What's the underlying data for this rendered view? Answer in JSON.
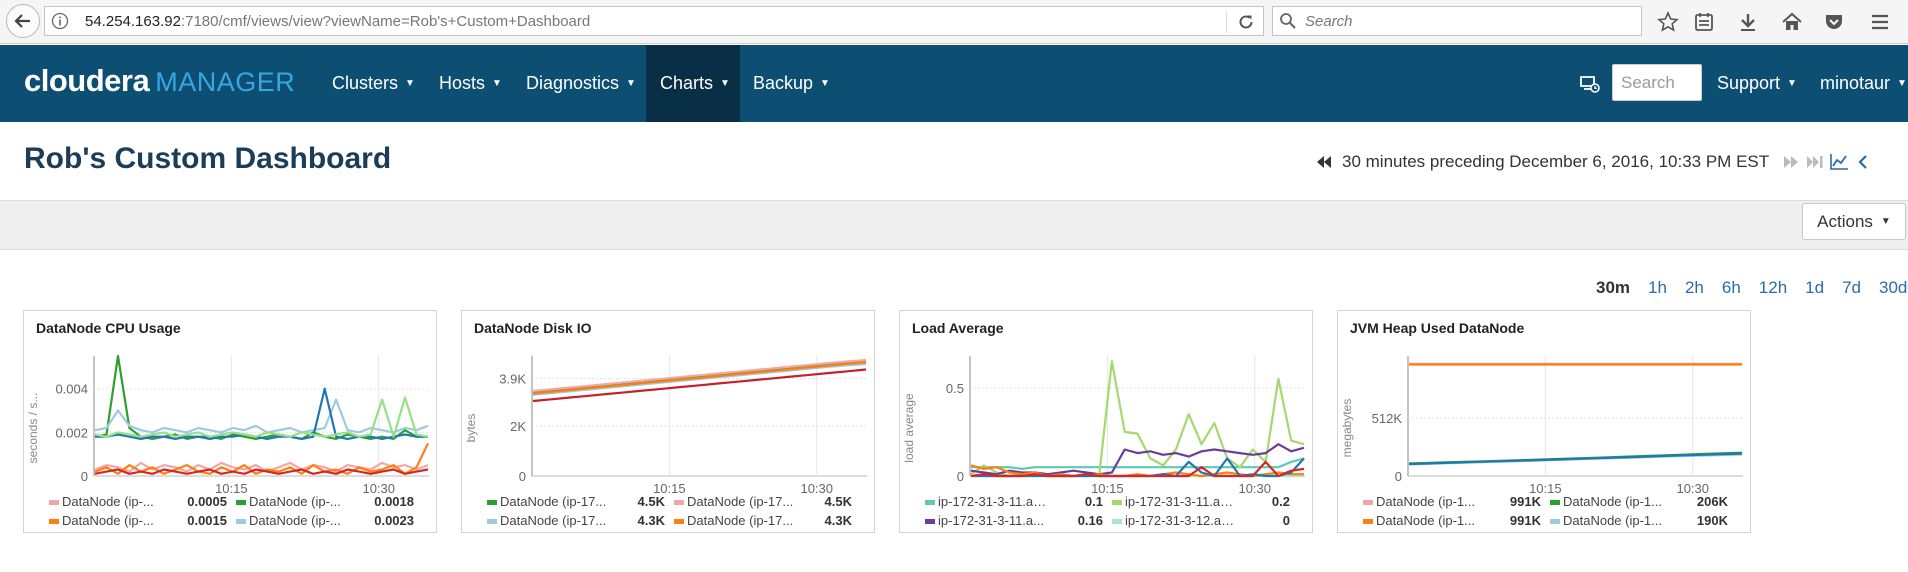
{
  "browser": {
    "url_host": "54.254.163.92",
    "url_rest": ":7180/cmf/views/view?viewName=Rob's+Custom+Dashboard",
    "search_placeholder": "Search"
  },
  "nav": {
    "logo_main": "cloudera",
    "logo_sub": "MANAGER",
    "items": [
      {
        "label": "Clusters"
      },
      {
        "label": "Hosts"
      },
      {
        "label": "Diagnostics"
      },
      {
        "label": "Charts"
      },
      {
        "label": "Backup"
      }
    ],
    "search_placeholder": "Search",
    "support": "Support",
    "user": "minotaur"
  },
  "page": {
    "title": "Rob's Custom Dashboard",
    "time_range_text": "30 minutes preceding December 6, 2016, 10:33 PM EST",
    "actions_label": "Actions",
    "ranges": [
      "30m",
      "1h",
      "2h",
      "6h",
      "12h",
      "1d",
      "7d",
      "30d"
    ],
    "active_range": "30m"
  },
  "chart_data": [
    {
      "type": "line",
      "title": "DataNode CPU Usage",
      "ylabel": "seconds / s...",
      "x_ticks": [
        "10:15",
        "10:30"
      ],
      "y_ticks": [
        "0.004",
        "0.002",
        "0"
      ],
      "ylim": [
        0,
        0.0055
      ],
      "series": [
        {
          "name": "DataNode (ip-...",
          "value_label": "0.0005",
          "color": "#f4a5a5",
          "values": [
            0.0003,
            0.0005,
            0.0004,
            0.0002,
            0.0006,
            0.0003,
            0.0005,
            0.0004,
            0.0002,
            0.0005,
            0.0003,
            0.0006,
            0.0004,
            0.0003,
            0.0005,
            0.0002,
            0.0004,
            0.0006,
            0.0003,
            0.0005,
            0.0004,
            0.0002,
            0.0005,
            0.0004,
            0.0003,
            0.0006,
            0.0004,
            0.0005,
            0.0003,
            0.0005
          ]
        },
        {
          "name": "DataNode (ip-...",
          "value_label": "0.0018",
          "color": "#2ca02c",
          "values": [
            0.0018,
            0.0019,
            0.0055,
            0.0022,
            0.0018,
            0.0017,
            0.0018,
            0.0019,
            0.0017,
            0.0018,
            0.0018,
            0.0017,
            0.0019,
            0.0018,
            0.0017,
            0.0018,
            0.0019,
            0.0018,
            0.0017,
            0.002,
            0.0018,
            0.0017,
            0.0019,
            0.0018,
            0.0017,
            0.0018,
            0.0017,
            0.0021,
            0.0018,
            0.0018
          ]
        },
        {
          "name": "DataNode (ip-...",
          "value_label": "0.0015",
          "color": "#ff7f0e",
          "values": [
            0.0002,
            0.0004,
            0.0001,
            0.0005,
            0.0002,
            0.0004,
            0.0001,
            0.0003,
            0.0005,
            0.0002,
            0.0001,
            0.0004,
            0.0002,
            0.0005,
            0.0001,
            0.0003,
            0.0002,
            0.0004,
            0.0001,
            0.0005,
            0.0002,
            0.0003,
            0.0001,
            0.0004,
            0.0002,
            0.0003,
            0.0005,
            0.0001,
            0.0004,
            0.0015
          ]
        },
        {
          "name": "DataNode (ip-...",
          "value_label": "0.0023",
          "color": "#9ecae1",
          "values": [
            0.0021,
            0.0022,
            0.003,
            0.0023,
            0.0021,
            0.002,
            0.0022,
            0.0021,
            0.002,
            0.0022,
            0.0021,
            0.002,
            0.0022,
            0.0021,
            0.0023,
            0.002,
            0.0021,
            0.0022,
            0.002,
            0.0021,
            0.0022,
            0.0035,
            0.0021,
            0.002,
            0.0022,
            0.0021,
            0.002,
            0.0022,
            0.0021,
            0.0023
          ]
        },
        {
          "name": "",
          "value_label": "",
          "color": "#1f77b4",
          "values": [
            0.0018,
            0.0018,
            0.0019,
            0.0018,
            0.0017,
            0.0018,
            0.0018,
            0.0017,
            0.0018,
            0.0018,
            0.0017,
            0.0018,
            0.0018,
            0.0019,
            0.0018,
            0.0017,
            0.0018,
            0.0018,
            0.0017,
            0.0018,
            0.004,
            0.0018,
            0.0017,
            0.0018,
            0.0018,
            0.0017,
            0.0018,
            0.0019,
            0.0018,
            0.0018
          ]
        },
        {
          "name": "",
          "value_label": "",
          "color": "#98df8a",
          "values": [
            0.0019,
            0.0018,
            0.002,
            0.0019,
            0.0018,
            0.0019,
            0.002,
            0.0018,
            0.0019,
            0.002,
            0.0018,
            0.0019,
            0.002,
            0.0019,
            0.0018,
            0.002,
            0.0019,
            0.0018,
            0.002,
            0.0019,
            0.0018,
            0.0019,
            0.002,
            0.0018,
            0.0019,
            0.0035,
            0.0018,
            0.0036,
            0.0019,
            0.0018
          ]
        },
        {
          "name": "",
          "value_label": "",
          "color": "#d62728",
          "values": [
            0.0001,
            0.0002,
            0.0003,
            0.0001,
            0.0002,
            0.0001,
            0.0003,
            0.0002,
            0.0001,
            0.0002,
            0.0003,
            0.0001,
            0.0002,
            0.0001,
            0.0003,
            0.0002,
            0.0001,
            0.0002,
            0.0003,
            0.0001,
            0.0002,
            0.0001,
            0.0003,
            0.0002,
            0.0001,
            0.0002,
            0.0003,
            0.0001,
            0.0002,
            0.0003
          ]
        }
      ]
    },
    {
      "type": "line",
      "title": "DataNode Disk IO",
      "ylabel": "bytes",
      "x_ticks": [
        "10:15",
        "10:30"
      ],
      "y_ticks": [
        "3.9K",
        "2K",
        "0"
      ],
      "ylim": [
        0,
        4800
      ],
      "series": [
        {
          "name": "DataNode (ip-17...",
          "value_label": "4.5K",
          "color": "#2ca02c",
          "values": [
            3350,
            3420,
            3490,
            3560,
            3630,
            3700,
            3770,
            3840,
            3910,
            3980,
            4050,
            4120,
            4190,
            4260,
            4330,
            4400,
            4470,
            4540,
            4600
          ]
        },
        {
          "name": "DataNode (ip-17...",
          "value_label": "4.5K",
          "color": "#f4a5a5",
          "values": [
            3400,
            3470,
            3540,
            3610,
            3680,
            3750,
            3820,
            3890,
            3960,
            4030,
            4100,
            4170,
            4240,
            4310,
            4380,
            4450,
            4520,
            4580,
            4640
          ]
        },
        {
          "name": "DataNode (ip-17...",
          "value_label": "4.3K",
          "color": "#9ecae1",
          "values": [
            3250,
            3320,
            3390,
            3460,
            3530,
            3600,
            3670,
            3740,
            3810,
            3880,
            3950,
            4020,
            4090,
            4160,
            4230,
            4300,
            4370,
            4430,
            4480
          ]
        },
        {
          "name": "DataNode (ip-17...",
          "value_label": "4.3K",
          "color": "#ff7f0e",
          "values": [
            3300,
            3370,
            3440,
            3510,
            3580,
            3650,
            3720,
            3790,
            3860,
            3930,
            4000,
            4070,
            4140,
            4210,
            4280,
            4350,
            4420,
            4490,
            4550
          ]
        },
        {
          "name": "",
          "value_label": "",
          "color": "#c7202d",
          "values": [
            3000,
            3070,
            3140,
            3210,
            3280,
            3350,
            3420,
            3490,
            3560,
            3630,
            3700,
            3770,
            3840,
            3910,
            3980,
            4050,
            4120,
            4190,
            4260
          ]
        }
      ]
    },
    {
      "type": "line",
      "title": "Load Average",
      "ylabel": "load average",
      "x_ticks": [
        "10:15",
        "10:30"
      ],
      "y_ticks": [
        "0.5",
        "0"
      ],
      "ylim": [
        0,
        0.68
      ],
      "series": [
        {
          "name": "ip-172-31-3-11.ap...",
          "value_label": "0.1",
          "color": "#5fc9b6",
          "values": [
            0.05,
            0.05,
            0.05,
            0.05,
            0.04,
            0.05,
            0.05,
            0.05,
            0.05,
            0.05,
            0.05,
            0.05,
            0.05,
            0.05,
            0.05,
            0.05,
            0.05,
            0.05,
            0.05,
            0.05,
            0.05,
            0.05,
            0.05,
            0.05,
            0.05,
            0.08,
            0.1
          ]
        },
        {
          "name": "ip-172-31-3-11.ap...",
          "value_label": "0.2",
          "color": "#a5d86e",
          "values": [
            0.01,
            0.06,
            0.02,
            0.0,
            0.01,
            0.02,
            0.0,
            0.01,
            0.0,
            0.01,
            0.0,
            0.65,
            0.25,
            0.24,
            0.1,
            0.06,
            0.15,
            0.35,
            0.18,
            0.3,
            0.1,
            0.05,
            0.15,
            0.08,
            0.55,
            0.2,
            0.18
          ]
        },
        {
          "name": "ip-172-31-3-11.a...",
          "value_label": "0.16",
          "color": "#6a3d9a",
          "values": [
            0.03,
            0.02,
            0.01,
            0.03,
            0.02,
            0.02,
            0.01,
            0.02,
            0.03,
            0.02,
            0.01,
            0.02,
            0.15,
            0.13,
            0.14,
            0.12,
            0.13,
            0.11,
            0.14,
            0.15,
            0.14,
            0.13,
            0.12,
            0.13,
            0.18,
            0.14,
            0.16
          ]
        },
        {
          "name": "ip-172-31-3-12.ap-s...",
          "value_label": "0",
          "color": "#a8e6c8",
          "values": [
            0.0,
            0.0,
            0.0,
            0.0,
            0.0,
            0.0,
            0.0,
            0.0,
            0.0,
            0.0,
            0.0,
            0.0,
            0.0,
            0.0,
            0.0,
            0.0,
            0.0,
            0.0,
            0.0,
            0.0,
            0.0,
            0.0,
            0.0,
            0.0,
            0.0,
            0.0,
            0.0
          ]
        },
        {
          "name": "",
          "value_label": "",
          "color": "#ff7f0e",
          "values": [
            0.06,
            0.04,
            0.05,
            0.02,
            0.01,
            0.02,
            0.0,
            0.01,
            0.0,
            0.0,
            0.01,
            0.0,
            0.0,
            0.01,
            0.0,
            0.01,
            0.02,
            0.01,
            0.0,
            0.01,
            0.02,
            0.01,
            0.0,
            0.01,
            0.02,
            0.01,
            0.01
          ]
        },
        {
          "name": "",
          "value_label": "",
          "color": "#1f77b4",
          "values": [
            0.0,
            0.0,
            0.0,
            0.0,
            0.0,
            0.0,
            0.0,
            0.0,
            0.0,
            0.0,
            0.0,
            0.0,
            0.0,
            0.0,
            0.0,
            0.01,
            0.0,
            0.08,
            0.02,
            0.0,
            0.1,
            0.0,
            0.01,
            0.0,
            0.0,
            0.02,
            0.1
          ]
        },
        {
          "name": "",
          "value_label": "",
          "color": "#d62728",
          "values": [
            0.0,
            0.01,
            0.0,
            0.0,
            0.0,
            0.01,
            0.0,
            0.0,
            0.0,
            0.01,
            0.0,
            0.0,
            0.0,
            0.0,
            0.0,
            0.0,
            0.0,
            0.0,
            0.05,
            0.0,
            0.0,
            0.0,
            0.0,
            0.08,
            0.0,
            0.03,
            0.04
          ]
        }
      ]
    },
    {
      "type": "line",
      "title": "JVM Heap Used DataNode",
      "ylabel": "megabytes",
      "x_ticks": [
        "10:15",
        "10:30"
      ],
      "y_ticks": [
        "512K",
        "0"
      ],
      "ylim": [
        0,
        1060000
      ],
      "series": [
        {
          "name": "DataNode (ip-1...",
          "value_label": "991K",
          "color": "#f4a5a5",
          "values": [
            991000,
            991000,
            991000,
            991000,
            991000,
            991000,
            991000,
            991000,
            991000,
            991000
          ]
        },
        {
          "name": "DataNode (ip-1...",
          "value_label": "206K",
          "color": "#2ca02c",
          "values": [
            110000,
            120000,
            130000,
            140000,
            150000,
            160000,
            172000,
            184000,
            195000,
            206000
          ]
        },
        {
          "name": "DataNode (ip-1...",
          "value_label": "991K",
          "color": "#ff7f0e",
          "values": [
            985000,
            985000,
            985000,
            985000,
            985000,
            985000,
            985000,
            985000,
            985000,
            985000
          ]
        },
        {
          "name": "DataNode (ip-1...",
          "value_label": "190K",
          "color": "#9ecae1",
          "values": [
            102000,
            112000,
            122000,
            132000,
            142000,
            152000,
            162000,
            172000,
            181000,
            190000
          ]
        },
        {
          "name": "",
          "value_label": "",
          "color": "#1f77b4",
          "values": [
            106000,
            116000,
            126000,
            136000,
            146000,
            156000,
            167000,
            178000,
            188000,
            198000
          ]
        }
      ]
    }
  ]
}
